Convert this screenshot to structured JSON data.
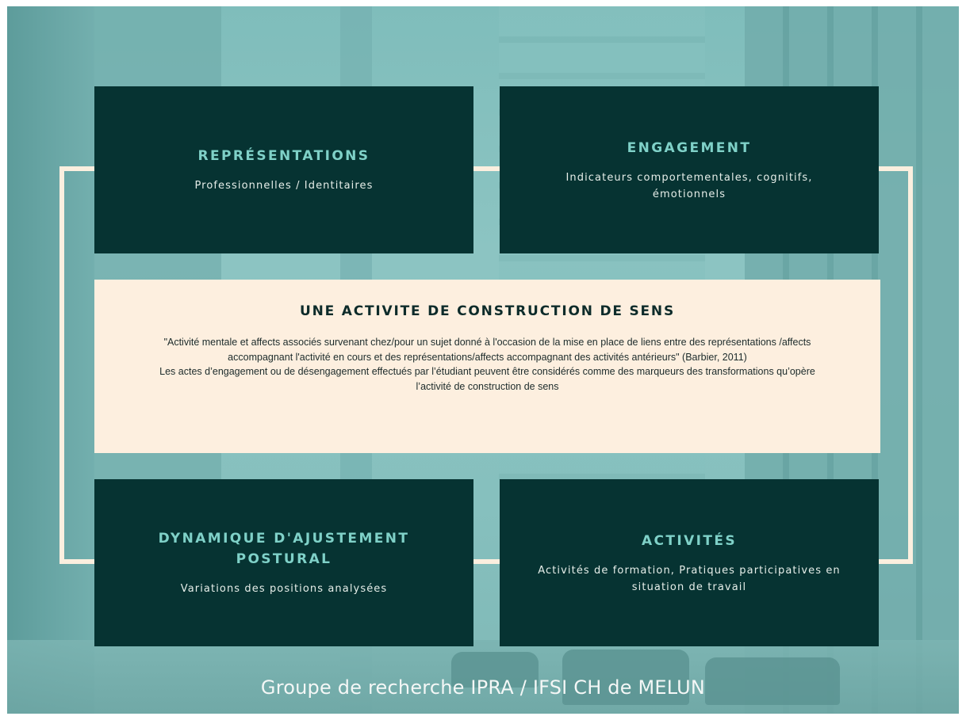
{
  "boxes": {
    "representations": {
      "title": "REPRÉSENTATIONS",
      "subtitle": "Professionnelles / Identitaires"
    },
    "engagement": {
      "title": "ENGAGEMENT",
      "subtitle": "Indicateurs comportementales, cognitifs, émotionnels"
    },
    "dynamique": {
      "title": "DYNAMIQUE D'AJUSTEMENT POSTURAL",
      "subtitle": "Variations des positions analysées"
    },
    "activites": {
      "title": "ACTIVITÉS",
      "subtitle": "Activités de formation, Pratiques participatives en situation de travail"
    }
  },
  "center": {
    "title": "UNE ACTIVITE DE CONSTRUCTION DE SENS",
    "quote": "\"Activité mentale et affects associés survenant chez/pour un sujet donné à l'occasion de la mise en place de liens entre des représentations /affects accompagnant l'activité en cours et des représentations/affects accompagnant des activités antérieurs\" (Barbier, 2011)",
    "note": "Les actes d’engagement ou de désengagement effectués par l’étudiant peuvent être considérés comme des marqueurs des transformations qu’opère l’activité de construction de sens"
  },
  "footer": "Groupe de recherche IPRA / IFSI CH de MELUN",
  "colors": {
    "box_bg": "#063332",
    "box_title": "#7fd1c8",
    "center_bg": "#fdefdf",
    "connector": "#fbefdf",
    "background": "#86c0be"
  }
}
